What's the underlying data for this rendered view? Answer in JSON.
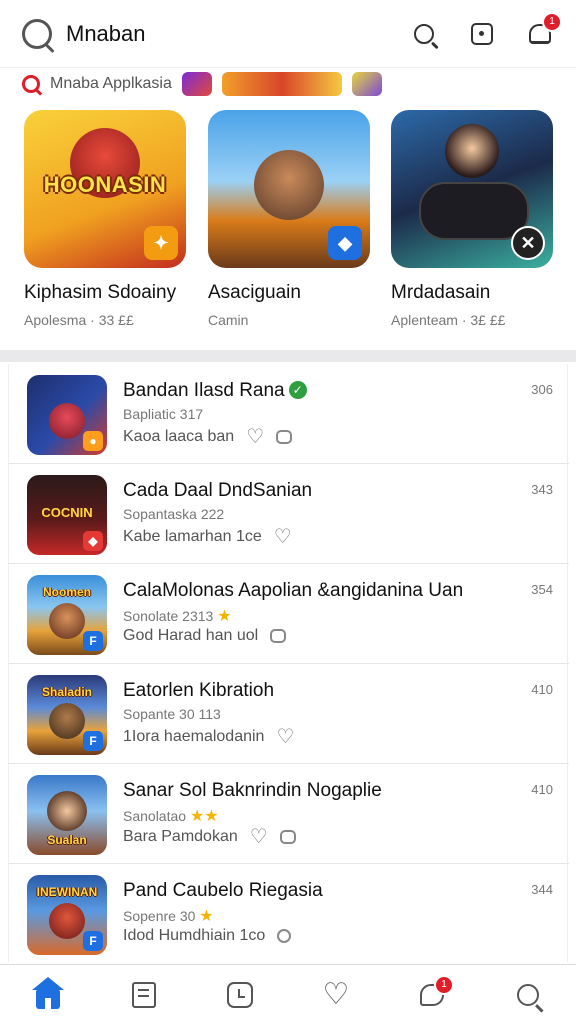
{
  "header": {
    "title": "Mnaban",
    "icons": [
      "app-logo-icon",
      "search-icon",
      "square-icon",
      "notification-icon"
    ],
    "notification_badge": "1"
  },
  "featured_header": {
    "label": "Mnaba Applkasia"
  },
  "featured": [
    {
      "name": "Kiphasim Sdoainy",
      "subtitle": "Apolesma · 33 ££",
      "thumb_caption": "HOONASIN",
      "colors": [
        "#f7c21c",
        "#c32d1d"
      ]
    },
    {
      "name": "Asaciguain",
      "subtitle": "Camin",
      "thumb_caption": "",
      "colors": [
        "#4aa3e8",
        "#d97c1a"
      ]
    },
    {
      "name": "Mrdadasain",
      "subtitle": "Aplenteam · 3£ ££",
      "thumb_caption": "",
      "colors": [
        "#1c2a4a",
        "#3bb0a0"
      ]
    }
  ],
  "list": [
    {
      "title": "Bandan Ilasd Rana",
      "verified": true,
      "subtitle": "Bapliatic 317",
      "meta": "Kaoa laaca ban",
      "count": "306",
      "thumb_caption": "",
      "colors": [
        "#1d2f6e",
        "#d43c2c"
      ],
      "mark_color": "#ff9d1c"
    },
    {
      "title": "Cada Daal DndSanian",
      "verified": false,
      "subtitle": "Sopantaska 222",
      "meta": "Kabe lamarhan 1ce",
      "count": "343",
      "thumb_caption": "COCNIN",
      "colors": [
        "#2a1a1a",
        "#c62828"
      ],
      "mark_color": "#e53935"
    },
    {
      "title": "CalaMolonas Aapolian &angidanina Uan",
      "verified": false,
      "subtitle": "Sonolate 2313",
      "meta": "God Harad han uol",
      "count": "354",
      "thumb_caption": "Noomen",
      "colors": [
        "#3a8fd9",
        "#e7a23a"
      ],
      "mark_color": "#1e6fe0"
    },
    {
      "title": "Eatorlen Kibratioh",
      "verified": false,
      "subtitle": "Sopante 30 113",
      "meta": "1Iora haemalodanin",
      "count": "410",
      "thumb_caption": "Shaladin",
      "colors": [
        "#2b3a7a",
        "#e8a23a"
      ],
      "mark_color": "#1e6fe0"
    },
    {
      "title": "Sanar Sol Baknrindin Nogaplie",
      "verified": false,
      "subtitle": "Sanolatao",
      "meta": "Bara Pamdokan",
      "count": "410",
      "thumb_caption": "Sualan",
      "colors": [
        "#3a78c9",
        "#8a4a2a"
      ],
      "mark_color": "#1e6fe0"
    },
    {
      "title": "Pand Caubelo Riegasia",
      "verified": false,
      "subtitle": "Sopenre 30",
      "meta": "Idod Humdhiain 1co",
      "count": "344",
      "thumb_caption": "INEWINAN",
      "colors": [
        "#2a5aa8",
        "#d96a2a"
      ],
      "mark_color": "#1e6fe0"
    }
  ],
  "list_stars": [
    "",
    "",
    "★",
    "",
    "★★",
    "★"
  ],
  "bottom_nav": {
    "items": [
      "home-icon",
      "document-icon",
      "clock-icon",
      "heart-icon",
      "chat-icon",
      "profile-icon"
    ],
    "chat_badge": "1"
  }
}
